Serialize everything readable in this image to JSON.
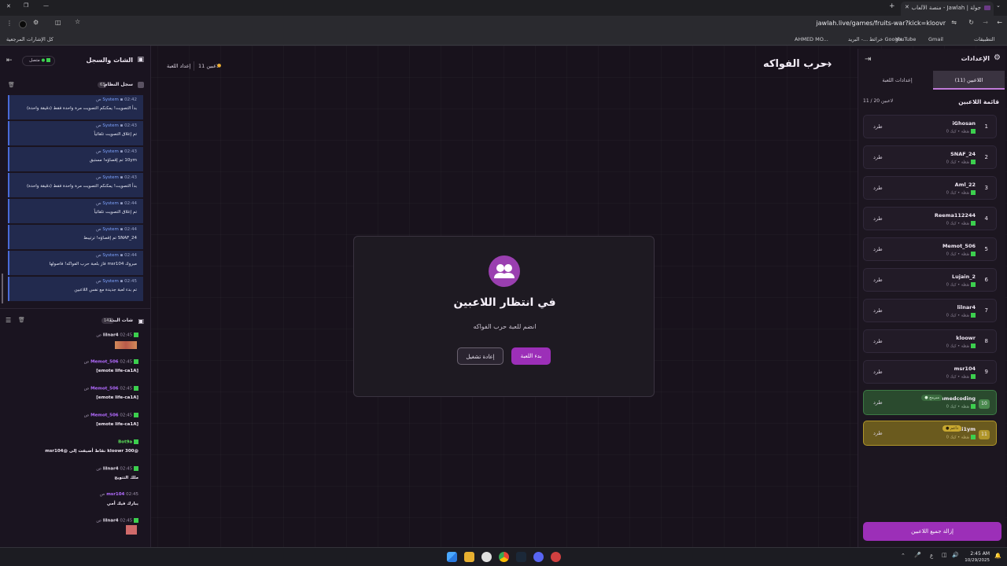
{
  "browser": {
    "tab_title": "جولة | Jawlah - منصة الألعاب ال...",
    "url": "jawlah.live/games/fruits-war?kick=kloovr",
    "bookmarks": [
      "كل الإشارات المرجعية",
      "AHMED MO...",
      "البريد -...",
      "خرائط Google",
      "YouTube",
      "Gmail",
      "التطبيقات"
    ]
  },
  "header": {
    "game_title": "حرب الفواكه",
    "players_count": "11 لاعبين",
    "settings_link": "إعداد اللعبة"
  },
  "chat_panel": {
    "title": "الشات والسجل",
    "status": "متصل",
    "system_log": {
      "title": "سجل النظام",
      "count": "63",
      "messages": [
        {
          "sender": "System",
          "time": "02:42 ص",
          "text": "بدأ التصويت! يمكنكم التصويت مرة واحدة فقط (دقيقة واحدة)"
        },
        {
          "sender": "System",
          "time": "02:43 ص",
          "text": "تم إغلاق التصويت تلقائياً"
        },
        {
          "sender": "System",
          "time": "02:43 ص",
          "text": "10ym تم إقصاؤه! مستبق"
        },
        {
          "sender": "System",
          "time": "02:43 ص",
          "text": "بدأ التصويت! يمكنكم التصويت مرة واحدة فقط (دقيقة واحدة)"
        },
        {
          "sender": "System",
          "time": "02:44 ص",
          "text": "تم إغلاق التصويت تلقائياً"
        },
        {
          "sender": "System",
          "time": "02:44 ص",
          "text": "SNAF_24 تم إقصاؤه! ترتيبط"
        },
        {
          "sender": "System",
          "time": "02:44 ص",
          "text": "مبروك msr104 فاز بلعبة حرب الفواكه! فاصولها"
        },
        {
          "sender": "System",
          "time": "02:45 ص",
          "text": "تم بدء لعبة جديدة مع نفس اللاعبين"
        }
      ]
    },
    "live_chat": {
      "title": "شات البث",
      "count": "142",
      "messages": [
        {
          "user": "lilnar4",
          "time": "02:45 ص",
          "text": ""
        },
        {
          "user": "Memot_506",
          "time": "02:45 ص",
          "text": "[emote life-ca1A]"
        },
        {
          "user": "Memot_506",
          "time": "02:45 ص",
          "text": "[emote life-ca1A]"
        },
        {
          "user": "Memot_506",
          "time": "02:45 ص",
          "text": "[emote life-ca1A]"
        },
        {
          "user": "Bot9a",
          "time": "",
          "text": "@kloowr 300 نقاط أضيفت إلى @msr104"
        },
        {
          "user": "lilnar4",
          "time": "02:45 ص",
          "text": "ملك التتويج"
        },
        {
          "user": "msr104",
          "time": "02:45 ص",
          "text": "يبارك فيك أمي"
        },
        {
          "user": "lilnar4",
          "time": "02:45 ص",
          "text": ""
        }
      ]
    }
  },
  "modal": {
    "title": "في انتظار اللاعبين",
    "subtitle": "انضم للعبة حرب الفواكه",
    "start_button": "بدء اللعبة",
    "restart_button": "إعادة تشغيل"
  },
  "settings_panel": {
    "title": "الإعدادات",
    "tab_players": "اللاعبين (11)",
    "tab_game_settings": "إعدادات اللعبة",
    "list_title": "قائمة اللاعبين",
    "list_count": "11 / 20 لاعبين",
    "kick_label": "طرد",
    "players": [
      {
        "num": "1",
        "name": "iGhosan",
        "sub": "0 نقطة • كيك",
        "badge": ""
      },
      {
        "num": "2",
        "name": "SNAF_24",
        "sub": "0 نقطة • كيك",
        "badge": ""
      },
      {
        "num": "3",
        "name": "Aml_22",
        "sub": "0 نقطة • كيك",
        "badge": ""
      },
      {
        "num": "4",
        "name": "Reema112244",
        "sub": "0 نقطة • كيك",
        "badge": ""
      },
      {
        "num": "5",
        "name": "Memot_506",
        "sub": "0 نقطة • كيك",
        "badge": ""
      },
      {
        "num": "6",
        "name": "Lujain_2",
        "sub": "0 نقطة • كيك",
        "badge": ""
      },
      {
        "num": "7",
        "name": "lilnar4",
        "sub": "0 نقطة • كيك",
        "badge": ""
      },
      {
        "num": "8",
        "name": "kloowr",
        "sub": "0 نقطة • كيك",
        "badge": ""
      },
      {
        "num": "9",
        "name": "msr104",
        "sub": "0 نقطة • كيك",
        "badge": ""
      },
      {
        "num": "10",
        "name": "ahmedcoding",
        "sub": "0 نقطة • كيك",
        "badge": "● مبرمج"
      },
      {
        "num": "11",
        "name": "1i1ym",
        "sub": "0 نقطة • كيك",
        "badge": "● داعم"
      }
    ],
    "remove_all_button": "إزالة جميع اللاعبين"
  },
  "taskbar": {
    "time": "2:45 AM",
    "date": "10/29/2025",
    "lang": "ع"
  }
}
